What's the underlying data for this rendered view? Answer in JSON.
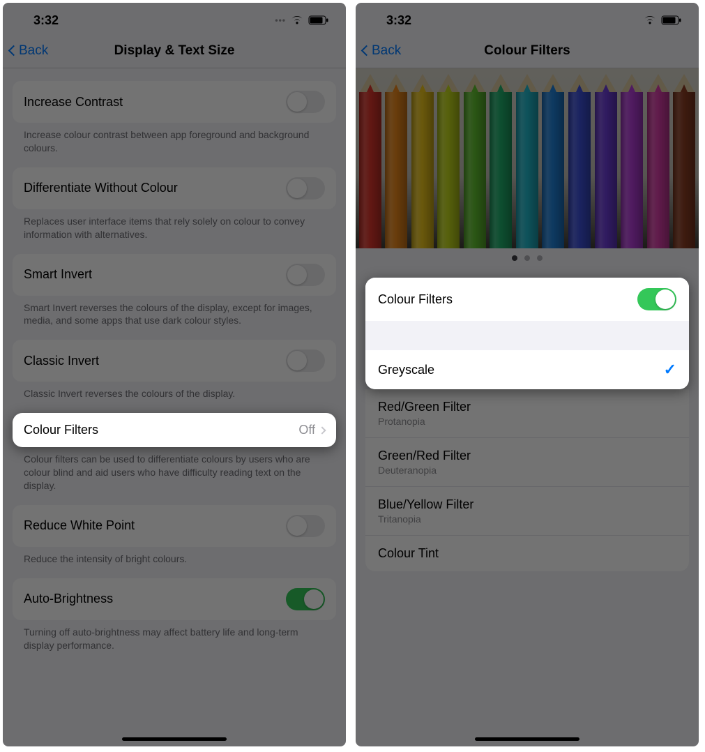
{
  "left": {
    "time": "3:32",
    "back": "Back",
    "title": "Display & Text Size",
    "rows": {
      "increaseContrast": {
        "label": "Increase Contrast",
        "desc": "Increase colour contrast between app foreground and background colours."
      },
      "diffWithoutColour": {
        "label": "Differentiate Without Colour",
        "desc": "Replaces user interface items that rely solely on colour to convey information with alternatives."
      },
      "smartInvert": {
        "label": "Smart Invert",
        "desc": "Smart Invert reverses the colours of the display, except for images, media, and some apps that use dark colour styles."
      },
      "classicInvert": {
        "label": "Classic Invert",
        "desc": "Classic Invert reverses the colours of the display."
      },
      "colourFilters": {
        "label": "Colour Filters",
        "value": "Off",
        "desc": "Colour filters can be used to differentiate colours by users who are colour blind and aid users who have difficulty reading text on the display."
      },
      "reduceWhitePoint": {
        "label": "Reduce White Point",
        "desc": "Reduce the intensity of bright colours."
      },
      "autoBrightness": {
        "label": "Auto-Brightness",
        "desc": "Turning off auto-brightness may affect battery life and long-term display performance."
      }
    }
  },
  "right": {
    "time": "3:32",
    "back": "Back",
    "title": "Colour Filters",
    "pencilColors": [
      "#d9352b",
      "#e8861b",
      "#e8c21b",
      "#c0d61b",
      "#5fbf2e",
      "#1fae6b",
      "#1fb6c9",
      "#1f7fd6",
      "#3c4fd6",
      "#6b3cd6",
      "#b23cd6",
      "#d63ca6",
      "#8a3c22"
    ],
    "toggle": {
      "label": "Colour Filters",
      "on": true
    },
    "options": {
      "greyscale": {
        "label": "Greyscale",
        "selected": true
      },
      "redGreen": {
        "label": "Red/Green Filter",
        "sub": "Protanopia"
      },
      "greenRed": {
        "label": "Green/Red Filter",
        "sub": "Deuteranopia"
      },
      "blueYellow": {
        "label": "Blue/Yellow Filter",
        "sub": "Tritanopia"
      },
      "tint": {
        "label": "Colour Tint"
      }
    }
  }
}
